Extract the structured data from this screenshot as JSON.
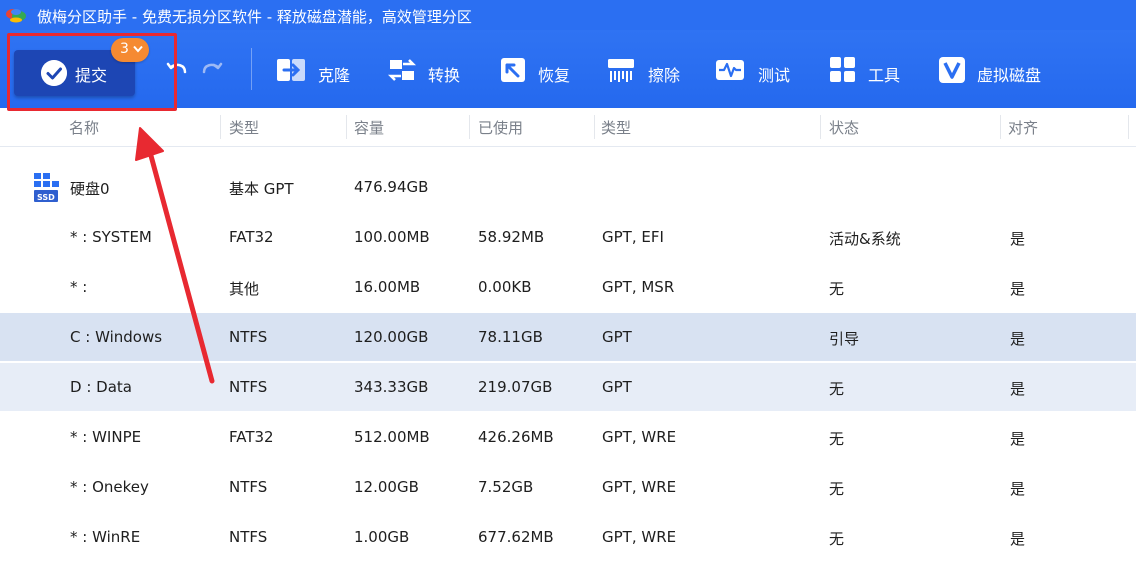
{
  "window": {
    "title": "傲梅分区助手 - 免费无损分区软件 - 释放磁盘潜能，高效管理分区"
  },
  "toolbar": {
    "submit_label": "提交",
    "pending_count": "3",
    "tools": [
      {
        "label": "克隆",
        "icon": "clone-icon"
      },
      {
        "label": "转换",
        "icon": "convert-icon"
      },
      {
        "label": "恢复",
        "icon": "recover-icon"
      },
      {
        "label": "擦除",
        "icon": "wipe-icon"
      },
      {
        "label": "测试",
        "icon": "test-icon"
      },
      {
        "label": "工具",
        "icon": "tools-icon"
      },
      {
        "label": "虚拟磁盘",
        "icon": "virtual-disk-icon"
      }
    ]
  },
  "table": {
    "columns": [
      "名称",
      "类型",
      "容量",
      "已使用",
      "类型",
      "状态",
      "对齐"
    ],
    "disk": {
      "name": "硬盘0",
      "type": "基本 GPT",
      "capacity": "476.94GB",
      "icon_badge": "SSD"
    },
    "partitions": [
      {
        "name": "* : SYSTEM",
        "fs": "FAT32",
        "capacity": "100.00MB",
        "used": "58.92MB",
        "ptype": "GPT, EFI",
        "status": "活动&系统",
        "aligned": "是"
      },
      {
        "name": "* :",
        "fs": "其他",
        "capacity": "16.00MB",
        "used": "0.00KB",
        "ptype": "GPT, MSR",
        "status": "无",
        "aligned": "是"
      },
      {
        "name": "C : Windows",
        "fs": "NTFS",
        "capacity": "120.00GB",
        "used": "78.11GB",
        "ptype": "GPT",
        "status": "引导",
        "aligned": "是"
      },
      {
        "name": "D : Data",
        "fs": "NTFS",
        "capacity": "343.33GB",
        "used": "219.07GB",
        "ptype": "GPT",
        "status": "无",
        "aligned": "是"
      },
      {
        "name": "* : WINPE",
        "fs": "FAT32",
        "capacity": "512.00MB",
        "used": "426.26MB",
        "ptype": "GPT, WRE",
        "status": "无",
        "aligned": "是"
      },
      {
        "name": "* : Onekey",
        "fs": "NTFS",
        "capacity": "12.00GB",
        "used": "7.52GB",
        "ptype": "GPT, WRE",
        "status": "无",
        "aligned": "是"
      },
      {
        "name": "* : WinRE",
        "fs": "NTFS",
        "capacity": "1.00GB",
        "used": "677.62MB",
        "ptype": "GPT, WRE",
        "status": "无",
        "aligned": "是"
      }
    ]
  },
  "colors": {
    "toolbar": "#2b6ff2",
    "submit_button": "#1d46b4",
    "badge": "#f58a32",
    "annotation": "#e82931",
    "selected_row": "#d8e2f2"
  }
}
